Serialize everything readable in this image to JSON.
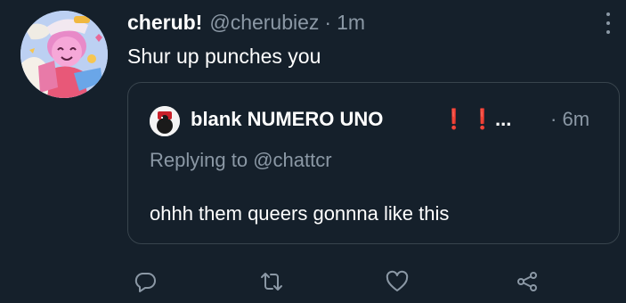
{
  "tweet": {
    "display_name": "cherub!",
    "handle": "@cherubiez",
    "separator": "·",
    "time": "1m",
    "text": "Shur up punches you"
  },
  "quoted_tweet": {
    "display_name": "blank NUMERO UNO",
    "emoji_1": "❗",
    "emoji_2": "❗",
    "ellipsis": "...",
    "separator": "·",
    "time": "6m",
    "replying_prefix": "Replying to",
    "replying_handle": "@chattcr",
    "text": "ohhh them queers gonnna like this"
  },
  "icons": {
    "more": "more-vertical-icon",
    "reply": "reply-icon",
    "retweet": "retweet-icon",
    "like": "heart-icon",
    "share": "share-icon"
  },
  "colors": {
    "background": "#15202b",
    "text_primary": "#ffffff",
    "text_secondary": "#8b98a5",
    "border": "#38444d",
    "emoji_red": "#e0202a"
  }
}
